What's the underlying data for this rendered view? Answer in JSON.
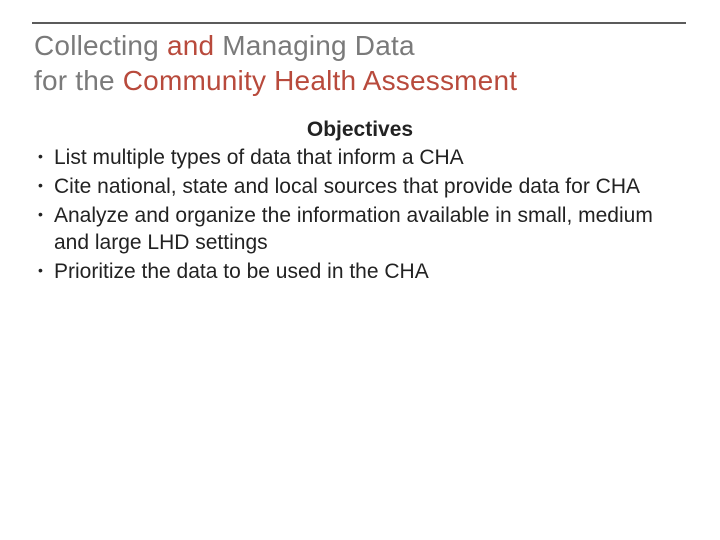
{
  "title": {
    "line1_a": "Collecting ",
    "line1_b": "and ",
    "line1_c": "Managing Data",
    "line2_a": "for the ",
    "line2_b": "Community Health Assessment"
  },
  "subheading": "Objectives",
  "bullets": [
    "List multiple types of data that inform a CHA",
    "Cite national, state and local sources that provide data for CHA",
    "Analyze and organize the information available in small, medium and large LHD settings",
    "Prioritize the data to be used in the CHA"
  ]
}
